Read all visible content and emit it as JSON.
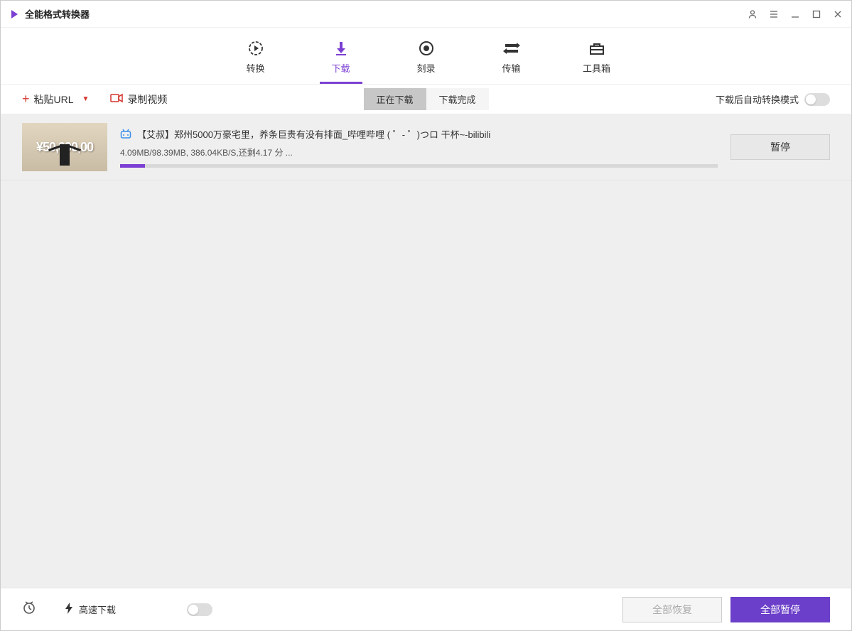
{
  "app": {
    "title": "全能格式转换器"
  },
  "tabs": [
    {
      "id": "convert",
      "label": "转换"
    },
    {
      "id": "download",
      "label": "下载"
    },
    {
      "id": "burn",
      "label": "刻录"
    },
    {
      "id": "transfer",
      "label": "传输"
    },
    {
      "id": "toolbox",
      "label": "工具箱"
    }
  ],
  "toolbar": {
    "paste_url_label": "粘贴URL",
    "record_video_label": "录制视频",
    "subtabs": {
      "downloading": "正在下载",
      "completed": "下载完成"
    },
    "auto_convert_label": "下载后自动转换模式"
  },
  "downloads": [
    {
      "title": "【艾叔】郑州5000万豪宅里，养条巨贵有没有排面_哔哩哔哩 ( ゜- ゜)つロ 干杯~-bilibili",
      "status": "4.09MB/98.39MB, 386.04KB/S,还剩4.17 分 ...",
      "progress_percent": 4.2,
      "thumb_text": "¥50,000,00",
      "pause_label": "暂停"
    }
  ],
  "footer": {
    "speed_label": "高速下载",
    "resume_all_label": "全部恢复",
    "pause_all_label": "全部暂停"
  }
}
